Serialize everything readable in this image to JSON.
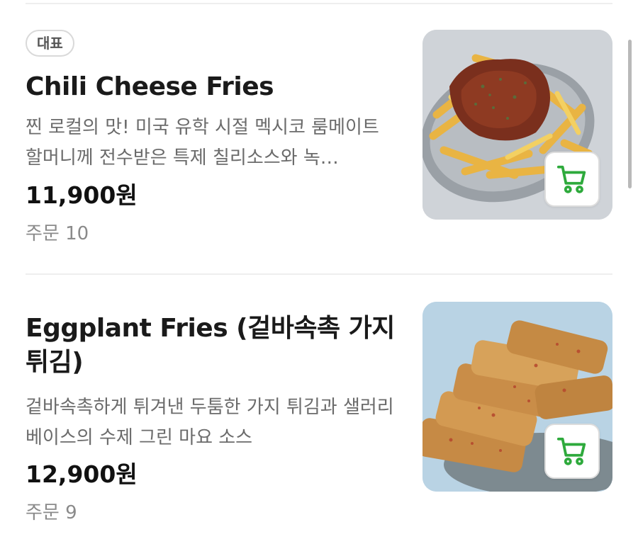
{
  "menu_items": [
    {
      "badge": "대표",
      "name": "Chili Cheese Fries",
      "description": "찐 로컬의 맛! 미국 유학 시절 멕시코 룸메이트 할머니께 전수받은 특제 칠리소스와 녹…",
      "price": "11,900원",
      "orders": "주문 10",
      "image": "chili-cheese-fries-photo",
      "cart_icon": "cart-icon"
    },
    {
      "name": "Eggplant Fries (겉바속촉 가지 튀김)",
      "description": "겉바속촉하게 튀겨낸 두툼한 가지 튀김과 샐러리 베이스의 수제 그린 마요 소스",
      "price": "12,900원",
      "orders": "주문 9",
      "image": "eggplant-fries-photo",
      "cart_icon": "cart-icon"
    }
  ],
  "colors": {
    "accent": "#2eaa3c",
    "text_primary": "#1a1a1a",
    "text_secondary": "#6b6b6b",
    "text_muted": "#8a8a8a",
    "divider": "#eeeeee"
  }
}
